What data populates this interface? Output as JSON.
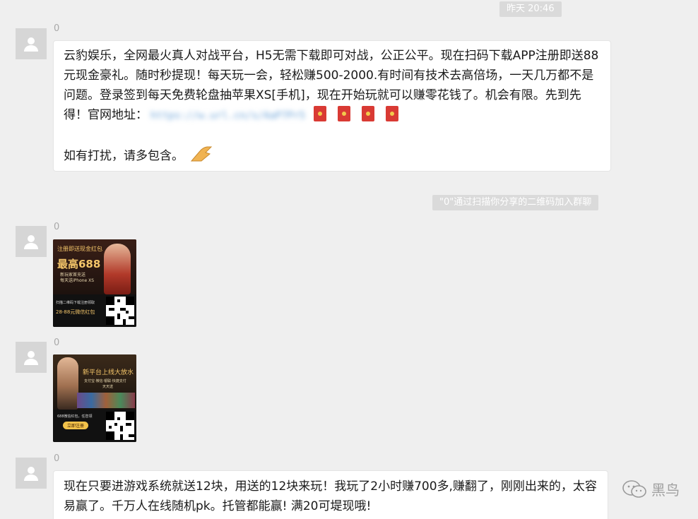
{
  "timestamp": "昨天 20:46",
  "system_notice": "\"0\"通过扫描你分享的二维码加入群聊",
  "messages": [
    {
      "sender": "0",
      "text_main": "云豹娱乐，全网最火真人对战平台，H5无需下载即可对战，公正公平。现在扫码下载APP注册即送88元现金豪礼。随时秒提现！每天玩一会，轻松赚500-2000.有时间有技术去高倍场，一天几万都不是问题。登录签到每天免费轮盘抽苹果XS[手机]，现在开始玩就可以赚零花钱了。机会有限。先到先得！官网地址：",
      "link": "https://w.url.cn/s/AaP7Pr5",
      "text_end": "如有打扰，请多包含。"
    },
    {
      "sender": "0",
      "image": {
        "banner": "注册即送现金红包",
        "headline": "最高688",
        "sub": "新玩家首充送",
        "sub2": "每天送iPhone XS",
        "footer1": "扫描二维码下载注册领取",
        "footer2": "28-88元微信红包"
      }
    },
    {
      "sender": "0",
      "image": {
        "banner": "新平台上线大放水",
        "sub": "支付宝·微信·银联·快捷支付",
        "sub2": "天天送",
        "footer1": "688微信红包，任您领",
        "button": "立即注册"
      }
    },
    {
      "sender": "0",
      "text": "现在只要进游戏系统就送12块，用送的12块来玩！我玩了2小时赚700多,赚翻了，刚刚出来的，太容易赢了。千万人在线随机pk。托管都能赢! 满20可堤现哦!"
    }
  ],
  "watermark": "黑鸟",
  "colors": {
    "background": "#efefef",
    "bubble": "#ffffff",
    "system_bg": "#dadada",
    "packet": "#d93a34"
  }
}
